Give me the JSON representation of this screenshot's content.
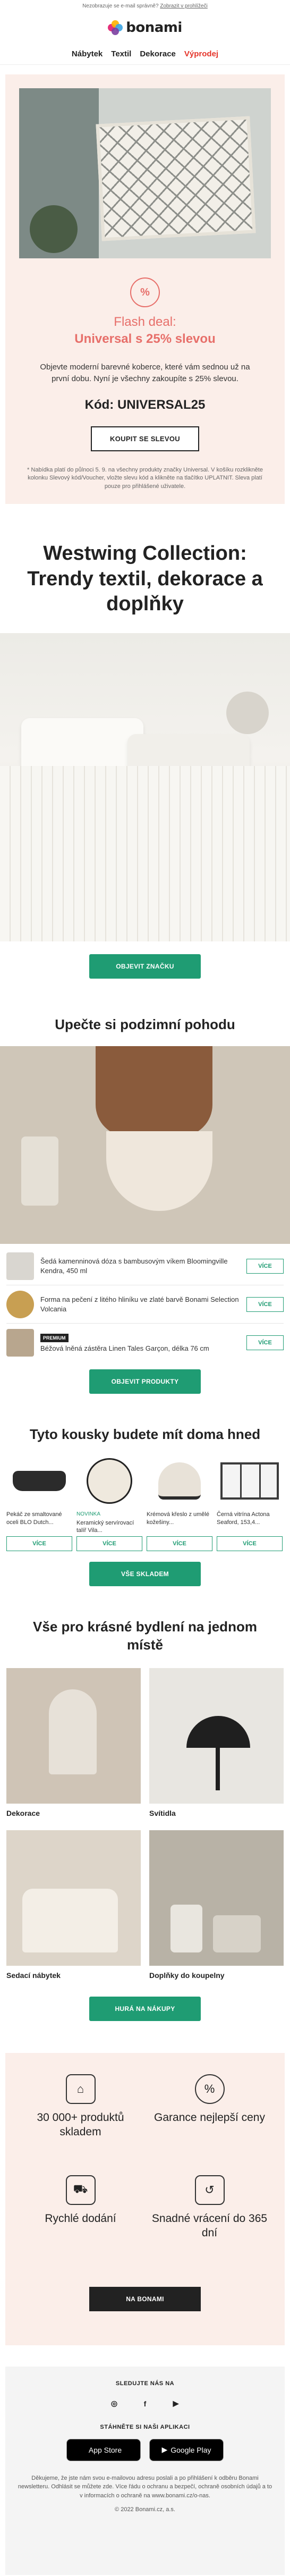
{
  "preheader": {
    "text": "Nezobrazuje se e-mail správně?",
    "link": "Zobrazit v prohlížeči"
  },
  "brand": {
    "name": "bonami",
    "accent": "#1f9c73",
    "sale_color": "#e5352b",
    "promo_bg": "#fbeee9"
  },
  "nav": [
    {
      "label": "Nábytek"
    },
    {
      "label": "Textil"
    },
    {
      "label": "Dekorace"
    },
    {
      "label": "Výprodej",
      "sale": true
    }
  ],
  "promo": {
    "badge": "%",
    "flash_title": "Flash deal:",
    "flash_subtitle": "Universal s 25% slevou",
    "text": "Objevte moderní barevné koberce, které vám sednou už na první dobu. Nyní je všechny zakoupíte s 25% slevou.",
    "code": "Kód: UNIVERSAL25",
    "button": "KOUPIT SE SLEVOU",
    "note": "* Nabídka platí do půlnoci 5. 9. na všechny produkty značky Universal. V košíku rozklikněte kolonku Slevový kód/Voucher, vložte slevu kód a klikněte na tlačítko UPLATNIT. Sleva platí pouze pro přihlášené uživatele."
  },
  "collection": {
    "title": "Westwing Collection: Trendy textil, dekorace a doplňky",
    "button": "OBJEVIT ZNAČKU"
  },
  "autumn": {
    "title": "Upečte si podzimní pohodu",
    "products": [
      {
        "name": "Šedá kamenninová dóza s bambusovým víkem Bloomingville Kendra, 450 ml",
        "button": "VÍCE",
        "color": "#d9d6d0"
      },
      {
        "name": "Forma na pečení z litého hliníku ve zlaté barvě Bonami Selection Volcania",
        "button": "VÍCE",
        "color": "#c89f52"
      },
      {
        "name": "Béžová lněná zástěra Linen Tales Garçon, délka 76 cm",
        "button": "VÍCE",
        "badge": "PREMIUM",
        "color": "#b8a68e"
      }
    ],
    "button": "OBJEVIT PRODUKTY"
  },
  "home_items": {
    "title": "Tyto kousky budete mít doma hned",
    "products": [
      {
        "name": "Pekáč ze smaltované oceli BLO Dutch...",
        "button": "VÍCE",
        "color": "#2b2b2b"
      },
      {
        "name": "Keramický servírovací talíř Vila...",
        "button": "VÍCE",
        "badge": "NOVINKA",
        "color": "#efe9de"
      },
      {
        "name": "Krémová křeslo z umělé kožešiny...",
        "button": "VÍCE",
        "color": "#e8e2d8"
      },
      {
        "name": "Černá vitrína Actona Seaford, 153,4...",
        "button": "VÍCE",
        "color": "#3b3b3b"
      }
    ],
    "button": "VŠE SKLADEM"
  },
  "categories": {
    "title": "Vše pro krásné bydlení na jednom místě",
    "items": [
      {
        "label": "Dekorace",
        "color": "#cfc4b6"
      },
      {
        "label": "Svítidla",
        "color": "#e8e6e1"
      },
      {
        "label": "Sedací nábytek",
        "color": "#ddd5c9"
      },
      {
        "label": "Doplňky do koupelny",
        "color": "#b8b2a6"
      }
    ],
    "button": "HURÁ NA NÁKUPY"
  },
  "usp": {
    "items": [
      {
        "icon": "sofa-icon",
        "text": "30 000+ produktů skladem"
      },
      {
        "icon": "badge-icon",
        "text": "Garance nejlepší ceny"
      },
      {
        "icon": "truck-icon",
        "text": "Rychlé dodání"
      },
      {
        "icon": "return-icon",
        "text": "Snadné vrácení do 365 dní"
      }
    ],
    "button": "NA BONAMI"
  },
  "footer": {
    "follow": "SLEDUJTE NÁS NA",
    "socials": [
      {
        "icon": "instagram-icon",
        "glyph": "◎"
      },
      {
        "icon": "facebook-icon",
        "glyph": "f"
      },
      {
        "icon": "youtube-icon",
        "glyph": "▶"
      }
    ],
    "app_label": "STÁHNĚTE SI NAŠI APLIKACI",
    "app_store": "App Store",
    "google_play": "Google Play",
    "legal": "Děkujeme, že jste nám svou e-mailovou adresu poslali a po přihlášení k odběru Bonami newsletteru. Odhlásit se můžete zde. Více řádu o ochranu a bezpečí, ochraně osobních údajů a to v informacích o ochraně na www.bonami.cz/o-nas.",
    "copyright": "© 2022 Bonami.cz, a.s."
  }
}
